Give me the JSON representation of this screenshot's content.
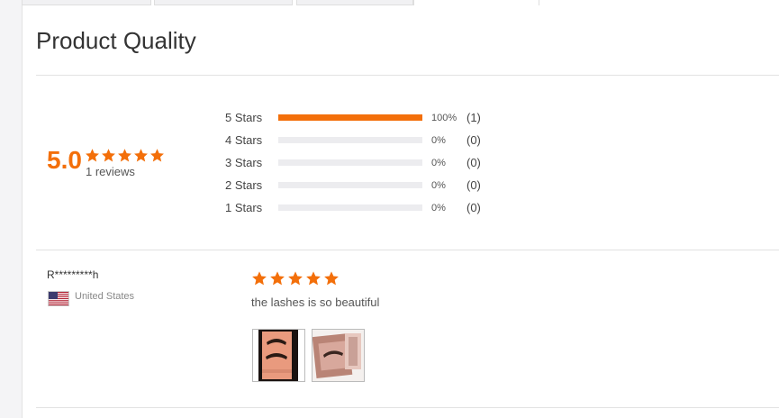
{
  "page": {
    "title": "Product Quality"
  },
  "summary": {
    "score": "5.0",
    "stars": 5,
    "reviews_text": "1 reviews"
  },
  "distribution": [
    {
      "label": "5  Stars",
      "percent_text": "100%",
      "count_text": "(1)",
      "fraction": 1.0
    },
    {
      "label": "4  Stars",
      "percent_text": "0%",
      "count_text": "(0)",
      "fraction": 0
    },
    {
      "label": "3  Stars",
      "percent_text": "0%",
      "count_text": "(0)",
      "fraction": 0
    },
    {
      "label": "2  Stars",
      "percent_text": "0%",
      "count_text": "(0)",
      "fraction": 0
    },
    {
      "label": "1  Stars",
      "percent_text": "0%",
      "count_text": "(0)",
      "fraction": 0
    }
  ],
  "review": {
    "reviewer": "R*********h",
    "country": "United States",
    "flag_icon": "us-flag-icon",
    "stars": 5,
    "text": "the lashes is so beautiful",
    "photos": [
      "review-photo-1",
      "review-photo-2"
    ]
  },
  "colors": {
    "accent": "#f36f0a",
    "bar_empty": "#ececef"
  }
}
